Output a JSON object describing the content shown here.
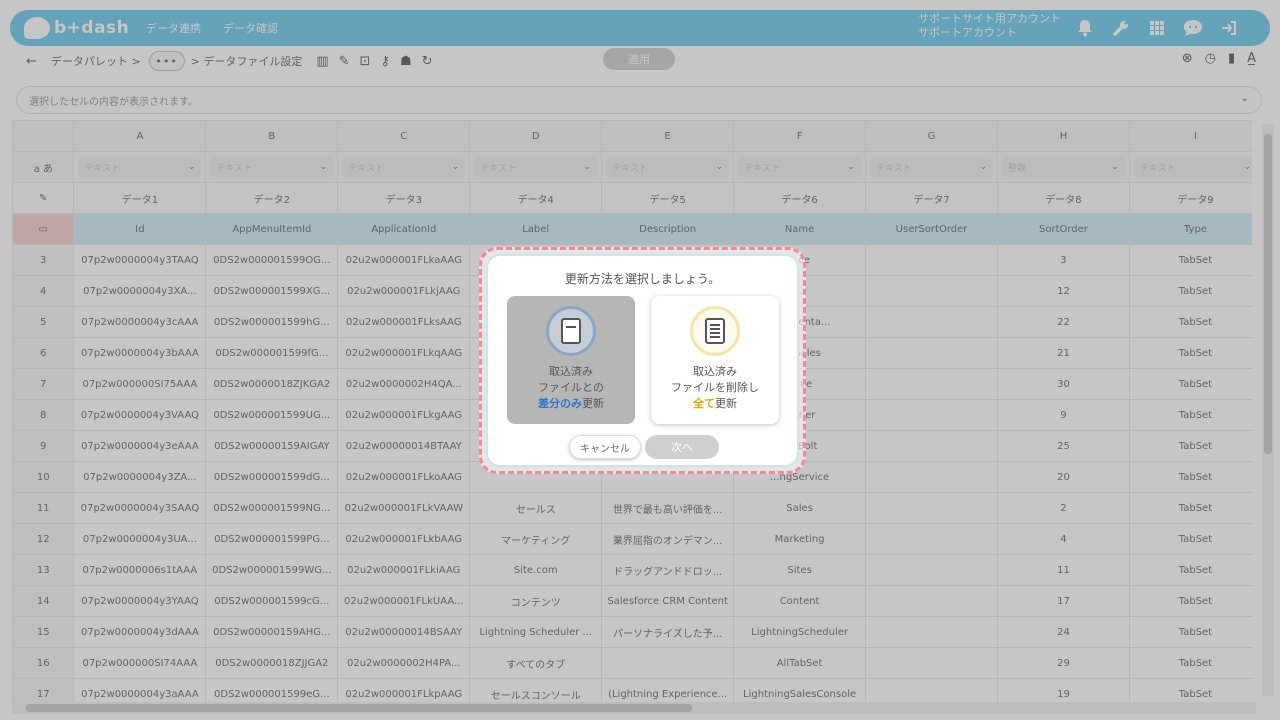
{
  "header": {
    "logo_text": "b+dash",
    "nav": [
      "データ連携",
      "データ確認"
    ],
    "account_line1": "サポートサイト用アカウント",
    "account_line2": "サポートアカウント"
  },
  "toolbar": {
    "back_icon": "arrow-left-icon",
    "crumb1": "データパレット  >",
    "dots": "•••",
    "crumb2": ">  データファイル設定",
    "apply_label": "適用"
  },
  "cellbar": {
    "placeholder": "選択したセルの内容が表示されます。"
  },
  "grid": {
    "columns": [
      "A",
      "B",
      "C",
      "D",
      "E",
      "F",
      "G",
      "H",
      "I"
    ],
    "type_row_label": "a あ",
    "types": [
      "テキスト",
      "テキスト",
      "テキスト",
      "テキスト",
      "テキスト",
      "テキスト",
      "テキスト",
      "整数",
      "テキスト"
    ],
    "names": [
      "データ1",
      "データ2",
      "データ3",
      "データ4",
      "データ5",
      "データ6",
      "データ7",
      "データ8",
      "データ9"
    ],
    "api_names": [
      "Id",
      "AppMenuItemId",
      "ApplicationId",
      "Label",
      "Description",
      "Name",
      "UserSortOrder",
      "SortOrder",
      "Type"
    ],
    "rows": [
      {
        "n": "3",
        "c": [
          "07p2w0000004y3TAAQ",
          "0DS2w000001599OG...",
          "02u2w000001FLkaAAG",
          "",
          "",
          "...ce",
          "",
          "3",
          "TabSet"
        ]
      },
      {
        "n": "4",
        "c": [
          "07p2w0000004y3XA...",
          "0DS2w000001599XG...",
          "02u2w000001FLkjAAG",
          "",
          "",
          "...r",
          "",
          "12",
          "TabSet"
        ]
      },
      {
        "n": "5",
        "c": [
          "07p2w0000004y3cAAA",
          "0DS2w000001599hG...",
          "02u2w000001FLksAAG",
          "L...",
          "",
          "...rumenta...",
          "",
          "22",
          "TabSet"
        ]
      },
      {
        "n": "6",
        "c": [
          "07p2w0000004y3bAAA",
          "0DS2w000001599fG...",
          "02u2w000001FLkqAAG",
          "",
          "",
          "...gSales",
          "",
          "21",
          "TabSet"
        ]
      },
      {
        "n": "7",
        "c": [
          "07p2w000000SI75AAA",
          "0DS2w0000018ZJKGA2",
          "02u2w0000002H4QA...",
          "",
          "",
          "...rce",
          "",
          "30",
          "TabSet"
        ]
      },
      {
        "n": "8",
        "c": [
          "07p2w0000004y3VAAQ",
          "0DS2w000001599UG...",
          "02u2w000001FLkgAAG",
          "",
          "",
          "...cher",
          "",
          "9",
          "TabSet"
        ]
      },
      {
        "n": "9",
        "c": [
          "07p2w0000004y3eAAA",
          "0DS2w00000159AIGAY",
          "02u2w00000014BTAAY",
          "",
          "",
          "...nBolt",
          "",
          "25",
          "TabSet"
        ]
      },
      {
        "n": "10",
        "c": [
          "07p2w0000004y3ZA...",
          "0DS2w000001599dG...",
          "02u2w000001FLkoAAG",
          "",
          "",
          "...ngService",
          "",
          "20",
          "TabSet"
        ]
      },
      {
        "n": "11",
        "c": [
          "07p2w0000004y3SAAQ",
          "0DS2w000001599NG...",
          "02u2w000001FLkVAAW",
          "セールス",
          "世界で最も高い評価を...",
          "Sales",
          "",
          "2",
          "TabSet"
        ]
      },
      {
        "n": "12",
        "c": [
          "07p2w0000004y3UA...",
          "0DS2w000001599PG...",
          "02u2w000001FLkbAAG",
          "マーケティング",
          "業界屈指のオンデマン...",
          "Marketing",
          "",
          "4",
          "TabSet"
        ]
      },
      {
        "n": "13",
        "c": [
          "07p2w0000006s1tAAA",
          "0DS2w000001599WG...",
          "02u2w000001FLkiAAG",
          "Site.com",
          "ドラッグアンドドロッ...",
          "Sites",
          "",
          "11",
          "TabSet"
        ]
      },
      {
        "n": "14",
        "c": [
          "07p2w0000004y3YAAQ",
          "0DS2w000001599cG...",
          "02u2w000001FLkUAA...",
          "コンテンツ",
          "Salesforce CRM Content",
          "Content",
          "",
          "17",
          "TabSet"
        ]
      },
      {
        "n": "15",
        "c": [
          "07p2w0000004y3dAAA",
          "0DS2w00000159AHG...",
          "02u2w00000014BSAAY",
          "Lightning Scheduler ...",
          "パーソナライズした予...",
          "LightningScheduler",
          "",
          "24",
          "TabSet"
        ]
      },
      {
        "n": "16",
        "c": [
          "07p2w000000SI74AAA",
          "0DS2w0000018ZJJGA2",
          "02u2w0000002H4PA...",
          "すべてのタブ",
          "",
          "AllTabSet",
          "",
          "29",
          "TabSet"
        ]
      },
      {
        "n": "17",
        "c": [
          "07p2w0000004y3aAAA",
          "0DS2w000001599eG...",
          "02u2w000001FLkpAAG",
          "セールスコンソール",
          "(Lightning Experience...",
          "LightningSalesConsole",
          "",
          "19",
          "TabSet"
        ]
      }
    ]
  },
  "dialog": {
    "title": "更新方法を選択しましょう。",
    "opt1_line1": "取込済み",
    "opt1_line2": "ファイルとの",
    "opt1_hl": "差分のみ",
    "opt1_tail": "更新",
    "opt2_line1": "取込済み",
    "opt2_line2": "ファイルを削除し",
    "opt2_hl": "全て",
    "opt2_tail": "更新",
    "cancel_label": "キャンセル",
    "next_label": "次へ"
  },
  "colors": {
    "header": "#56c3ea",
    "api_row": "#c9e8f5",
    "dialog_border": "#f08a9a",
    "highlight_blue": "#2e78c4",
    "highlight_yellow": "#e7a400"
  }
}
